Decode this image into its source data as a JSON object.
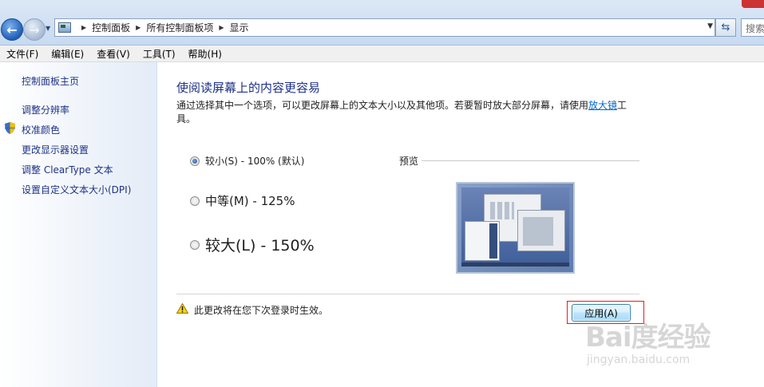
{
  "address_bar": {
    "breadcrumbs": [
      "控制面板",
      "所有控制面板项",
      "显示"
    ],
    "search_placeholder": "搜索"
  },
  "menu": {
    "items": [
      "文件(F)",
      "编辑(E)",
      "查看(V)",
      "工具(T)",
      "帮助(H)"
    ]
  },
  "sidebar": {
    "items": [
      {
        "label": "控制面板主页"
      },
      {
        "label": "调整分辨率"
      },
      {
        "label": "校准颜色",
        "icon": "shield-icon"
      },
      {
        "label": "更改显示器设置"
      },
      {
        "label": "调整 ClearType 文本"
      },
      {
        "label": "设置自定义文本大小(DPI)"
      }
    ]
  },
  "main": {
    "heading": "使阅读屏幕上的内容更容易",
    "description_before": "通过选择其中一个选项，可以更改屏幕上的文本大小以及其他项。若要暂时放大部分屏幕，请使用",
    "description_link": "放大镜",
    "description_after": "工具。",
    "options": [
      {
        "label": "较小(S) - 100% (默认)",
        "selected": true
      },
      {
        "label": "中等(M) - 125%",
        "selected": false
      },
      {
        "label": "较大(L) - 150%",
        "selected": false
      }
    ],
    "preview_label": "预览",
    "warning_text": "此更改将在您下次登录时生效。",
    "apply_label": "应用(A)"
  },
  "watermark": {
    "logo": "Bai度经验",
    "sub": "jingyan.baidu.com"
  },
  "colors": {
    "link": "#1e3287",
    "accent": "#3c7fb1",
    "highlight": "#e02020"
  }
}
